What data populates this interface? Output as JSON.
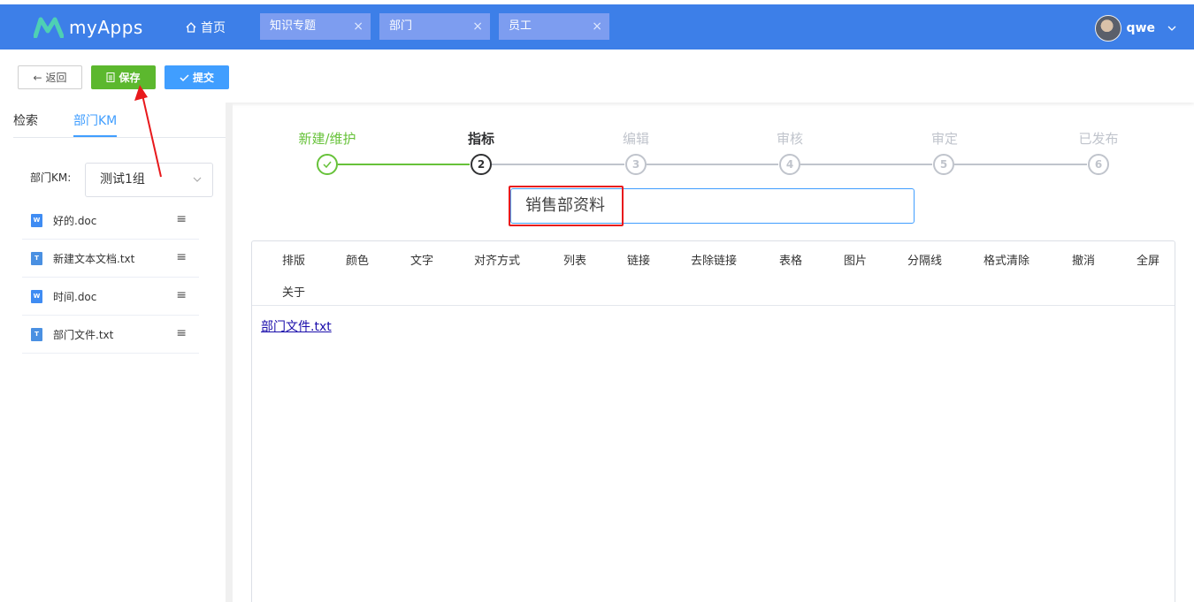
{
  "app": {
    "name": "myApps"
  },
  "nav": {
    "home_label": "首页",
    "tabs": [
      {
        "label": "知识专题",
        "close": "×"
      },
      {
        "label": "部门",
        "close": "×"
      },
      {
        "label": "员工",
        "close": "×"
      }
    ],
    "user": {
      "name": "qwe"
    }
  },
  "toolbar": {
    "back_label": "返回",
    "save_label": "保存",
    "submit_label": "提交"
  },
  "sidebar": {
    "tabs": [
      "检索",
      "部门KM"
    ],
    "km_label": "部门KM:",
    "km_selected": "测试1组",
    "files": [
      {
        "name": "好的.doc",
        "type": "W",
        "menu": "≡"
      },
      {
        "name": "新建文本文档.txt",
        "type": "T",
        "menu": "≡"
      },
      {
        "name": "时间.doc",
        "type": "W",
        "menu": "≡"
      },
      {
        "name": "部门文件.txt",
        "type": "T",
        "menu": "≡"
      }
    ]
  },
  "steps": [
    {
      "title": "新建/维护",
      "num": "1",
      "status": "done"
    },
    {
      "title": "指标",
      "num": "2",
      "status": "active"
    },
    {
      "title": "编辑",
      "num": "3",
      "status": "pending"
    },
    {
      "title": "审核",
      "num": "4",
      "status": "pending"
    },
    {
      "title": "审定",
      "num": "5",
      "status": "pending"
    },
    {
      "title": "已发布",
      "num": "6",
      "status": "pending"
    }
  ],
  "document": {
    "title_value": "销售部资料",
    "link_text": "部门文件.txt"
  },
  "editor_toolbar": [
    "排版",
    "颜色",
    "文字",
    "对齐方式",
    "列表",
    "链接",
    "去除链接",
    "表格",
    "图片",
    "分隔线",
    "格式清除",
    "撤消",
    "全屏",
    "关于"
  ],
  "colors": {
    "header": "#3d7fe8",
    "save": "#5cb82e",
    "submit": "#409eff",
    "step_done": "#67c23a",
    "highlight": "#e8191c"
  }
}
